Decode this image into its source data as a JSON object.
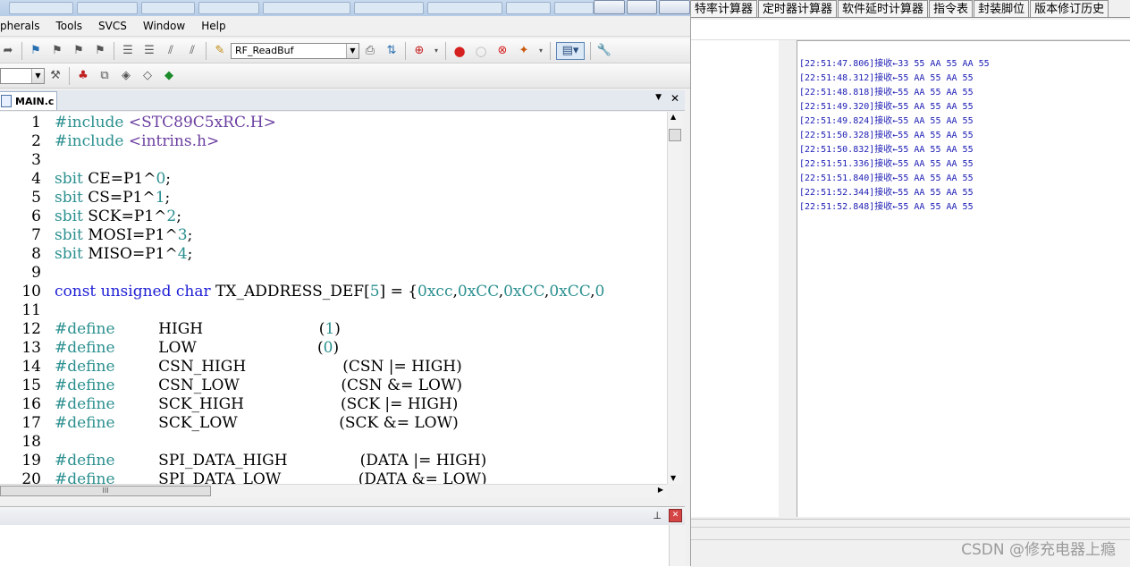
{
  "menubar": {
    "items": [
      "pherals",
      "Tools",
      "SVCS",
      "Window",
      "Help"
    ]
  },
  "toolbar": {
    "target_combo": "RF_ReadBuf",
    "second_combo": ""
  },
  "doc_tab": {
    "filename": "MAIN.c",
    "menu_arrow": "▼",
    "close_glyph": "✕"
  },
  "editor": {
    "lines": [
      {
        "n": "1",
        "segs": [
          {
            "t": "#include ",
            "c": "pp"
          },
          {
            "t": "<STC89C5xRC.H>",
            "c": "inc"
          }
        ]
      },
      {
        "n": "2",
        "segs": [
          {
            "t": "#include ",
            "c": "pp"
          },
          {
            "t": "<intrins.h>",
            "c": "inc"
          }
        ]
      },
      {
        "n": "3",
        "segs": []
      },
      {
        "n": "4",
        "segs": [
          {
            "t": "sbit ",
            "c": "pp"
          },
          {
            "t": "CE=P1^",
            "c": ""
          },
          {
            "t": "0",
            "c": "num"
          },
          {
            "t": ";",
            "c": ""
          }
        ]
      },
      {
        "n": "5",
        "segs": [
          {
            "t": "sbit ",
            "c": "pp"
          },
          {
            "t": "CS=P1^",
            "c": ""
          },
          {
            "t": "1",
            "c": "num"
          },
          {
            "t": ";",
            "c": ""
          }
        ]
      },
      {
        "n": "6",
        "segs": [
          {
            "t": "sbit ",
            "c": "pp"
          },
          {
            "t": "SCK=P1^",
            "c": ""
          },
          {
            "t": "2",
            "c": "num"
          },
          {
            "t": ";",
            "c": ""
          }
        ]
      },
      {
        "n": "7",
        "segs": [
          {
            "t": "sbit ",
            "c": "pp"
          },
          {
            "t": "MOSI=P1^",
            "c": ""
          },
          {
            "t": "3",
            "c": "num"
          },
          {
            "t": ";",
            "c": ""
          }
        ]
      },
      {
        "n": "8",
        "segs": [
          {
            "t": "sbit ",
            "c": "pp"
          },
          {
            "t": "MISO=P1^",
            "c": ""
          },
          {
            "t": "4",
            "c": "num"
          },
          {
            "t": ";",
            "c": ""
          }
        ]
      },
      {
        "n": "9",
        "segs": []
      },
      {
        "n": "10",
        "segs": [
          {
            "t": "const unsigned char ",
            "c": "kw"
          },
          {
            "t": "TX_ADDRESS_DEF[",
            "c": ""
          },
          {
            "t": "5",
            "c": "num"
          },
          {
            "t": "] = {",
            "c": ""
          },
          {
            "t": "0xcc",
            "c": "num"
          },
          {
            "t": ",",
            "c": ""
          },
          {
            "t": "0xCC",
            "c": "num"
          },
          {
            "t": ",",
            "c": ""
          },
          {
            "t": "0xCC",
            "c": "num"
          },
          {
            "t": ",",
            "c": ""
          },
          {
            "t": "0xCC",
            "c": "num"
          },
          {
            "t": ",",
            "c": ""
          },
          {
            "t": "0",
            "c": "num"
          }
        ]
      },
      {
        "n": "11",
        "segs": []
      },
      {
        "n": "12",
        "segs": [
          {
            "t": "#define         ",
            "c": "pp"
          },
          {
            "t": "HIGH                        (",
            "c": ""
          },
          {
            "t": "1",
            "c": "num"
          },
          {
            "t": ")",
            "c": ""
          }
        ]
      },
      {
        "n": "13",
        "segs": [
          {
            "t": "#define         ",
            "c": "pp"
          },
          {
            "t": "LOW                         (",
            "c": ""
          },
          {
            "t": "0",
            "c": "num"
          },
          {
            "t": ")",
            "c": ""
          }
        ]
      },
      {
        "n": "14",
        "segs": [
          {
            "t": "#define         ",
            "c": "pp"
          },
          {
            "t": "CSN_HIGH                    (CSN |= HIGH)",
            "c": ""
          }
        ]
      },
      {
        "n": "15",
        "segs": [
          {
            "t": "#define         ",
            "c": "pp"
          },
          {
            "t": "CSN_LOW                     (CSN &= LOW)",
            "c": ""
          }
        ]
      },
      {
        "n": "16",
        "segs": [
          {
            "t": "#define         ",
            "c": "pp"
          },
          {
            "t": "SCK_HIGH                    (SCK |= HIGH)",
            "c": ""
          }
        ]
      },
      {
        "n": "17",
        "segs": [
          {
            "t": "#define         ",
            "c": "pp"
          },
          {
            "t": "SCK_LOW                     (SCK &= LOW)",
            "c": ""
          }
        ]
      },
      {
        "n": "18",
        "segs": []
      },
      {
        "n": "19",
        "segs": [
          {
            "t": "#define         ",
            "c": "pp"
          },
          {
            "t": "SPI_DATA_HIGH               (DATA |= HIGH)",
            "c": ""
          }
        ]
      },
      {
        "n": "20",
        "segs": [
          {
            "t": "#define         ",
            "c": "pp"
          },
          {
            "t": "SPI_DATA_LOW                (DATA &= LOW)",
            "c": ""
          }
        ]
      }
    ]
  },
  "hscroll": {
    "grip": "III"
  },
  "serial_tool": {
    "tabs": [
      "特率计算器",
      "定时器计算器",
      "软件延时计算器",
      "指令表",
      "封装脚位",
      "版本修订历史"
    ],
    "receive_log": [
      "[22:51:47.806]接收←33 55 AA 55 AA 55",
      "[22:51:48.312]接收←55 AA 55 AA 55",
      "[22:51:48.818]接收←55 AA 55 AA 55",
      "[22:51:49.320]接收←55 AA 55 AA 55",
      "[22:51:49.824]接收←55 AA 55 AA 55",
      "[22:51:50.328]接收←55 AA 55 AA 55",
      "[22:51:50.832]接收←55 AA 55 AA 55",
      "[22:51:51.336]接收←55 AA 55 AA 55",
      "[22:51:51.840]接收←55 AA 55 AA 55",
      "[22:51:52.344]接收←55 AA 55 AA 55",
      "[22:51:52.848]接收←55 AA 55 AA 55"
    ]
  },
  "watermark": "CSDN @修充电器上瘾"
}
